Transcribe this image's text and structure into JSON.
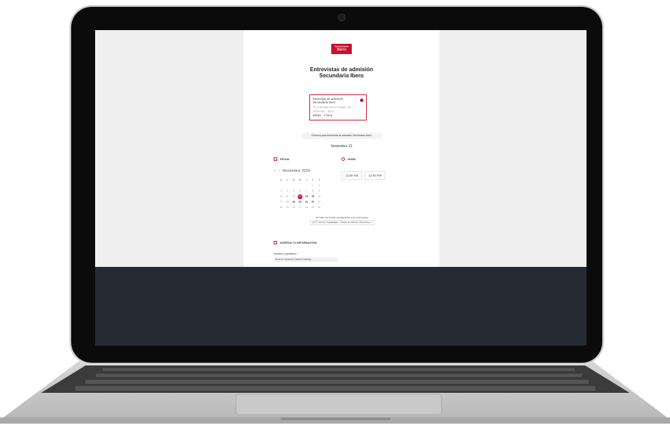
{
  "logo": {
    "top": "Secundaria",
    "bottom": "Ibero"
  },
  "title": {
    "line1": "Entrevistas de admisión",
    "line2": "Secundaria Ibero"
  },
  "event_card": {
    "name": "Entrevista de admisión Secundaria Ibero",
    "description": "Tu consulta con el equipo de admisión · Ibero",
    "duration": "Medio · 1 hora"
  },
  "notice": "Reserva para Entrevista de admisión Secundaria Ibero",
  "date_heading": "Noviembre 13",
  "fecha": {
    "label": "FECHA"
  },
  "hora": {
    "label": "HORA"
  },
  "calendar": {
    "month_label": "Noviembre 2024",
    "weekdays": [
      "D",
      "L",
      "M",
      "M",
      "J",
      "V",
      "S"
    ],
    "weeks": [
      [
        "",
        "",
        "",
        "",
        "",
        "1",
        "2"
      ],
      [
        "3",
        "4",
        "5",
        "6",
        "7",
        "8",
        "9"
      ],
      [
        "10",
        "11",
        "12",
        "13",
        "14",
        "15",
        "16"
      ],
      [
        "17",
        "18",
        "19",
        "20",
        "21",
        "22",
        "23"
      ],
      [
        "24",
        "25",
        "26",
        "27",
        "28",
        "29",
        "30"
      ]
    ],
    "selected": "13"
  },
  "time_slots": [
    "11:00 AM",
    "12:00 PM"
  ],
  "timezone": {
    "label": "Todas las fechas corresponden a la zona horaria",
    "value": "(UTC-06:00) Guadalajara, Ciudad de México, Monterrey"
  },
  "info_section": {
    "label": "AGREGA TU INFORMACIÓN"
  },
  "name_field": {
    "label": "Nombre y apellidos *",
    "value": "Sharon Cordova Carrera Garibay"
  }
}
